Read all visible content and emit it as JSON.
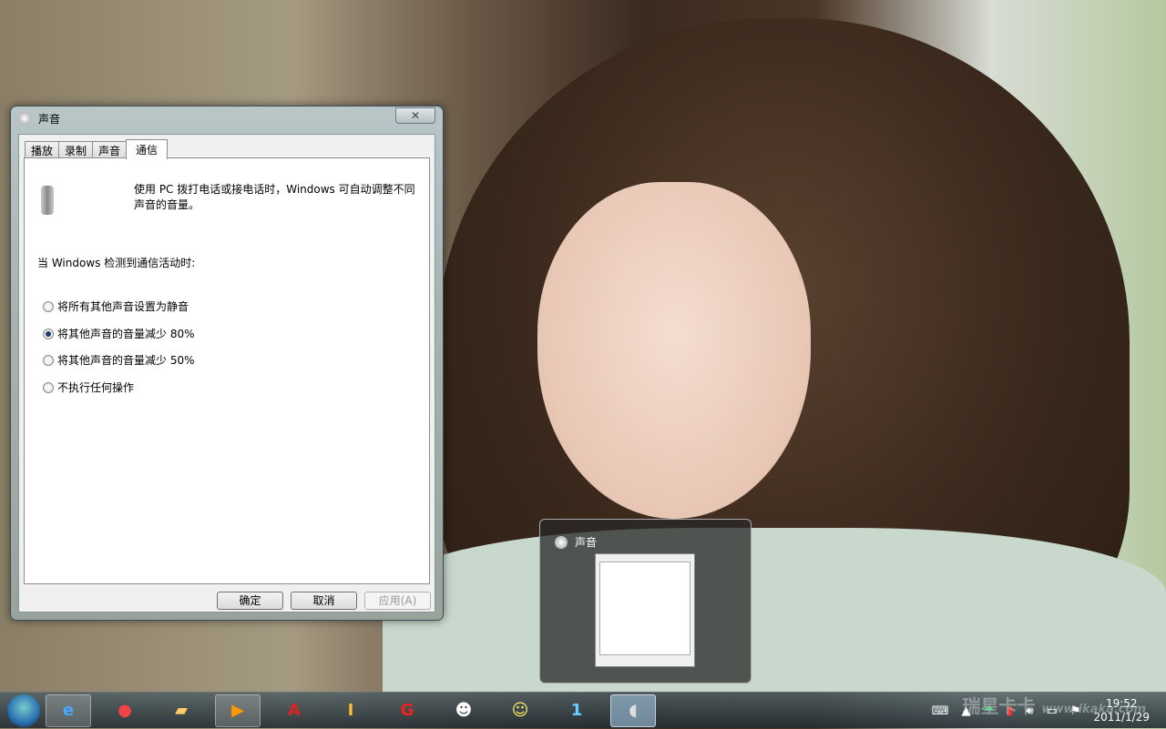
{
  "dialog": {
    "title": "声音",
    "close": "✕",
    "tabs": [
      "播放",
      "录制",
      "声音",
      "通信"
    ],
    "description": "使用 PC 拨打电话或接电话时，Windows 可自动调整不同声音的音量。",
    "label": "当 Windows 检测到通信活动时:",
    "options": [
      {
        "label": "将所有其他声音设置为静音",
        "checked": false
      },
      {
        "label": "将其他声音的音量减少 80%",
        "checked": true
      },
      {
        "label": "将其他声音的音量减少 50%",
        "checked": false
      },
      {
        "label": "不执行任何操作",
        "checked": false
      }
    ],
    "buttons": {
      "ok": "确定",
      "cancel": "取消",
      "apply": "应用(A)"
    }
  },
  "thumbnail": {
    "title": "声音"
  },
  "taskbar": {
    "apps": [
      "internet-explorer",
      "chrome",
      "explorer",
      "media-player",
      "autocad",
      "illustrator-pro",
      "gp",
      "qq",
      "yellow-app",
      "calendar",
      "sound"
    ],
    "clock": {
      "time": "19:52",
      "date": "2011/1/29"
    }
  },
  "watermark": {
    "text": "瑞星卡卡",
    "url": "www.ikaka.com"
  }
}
